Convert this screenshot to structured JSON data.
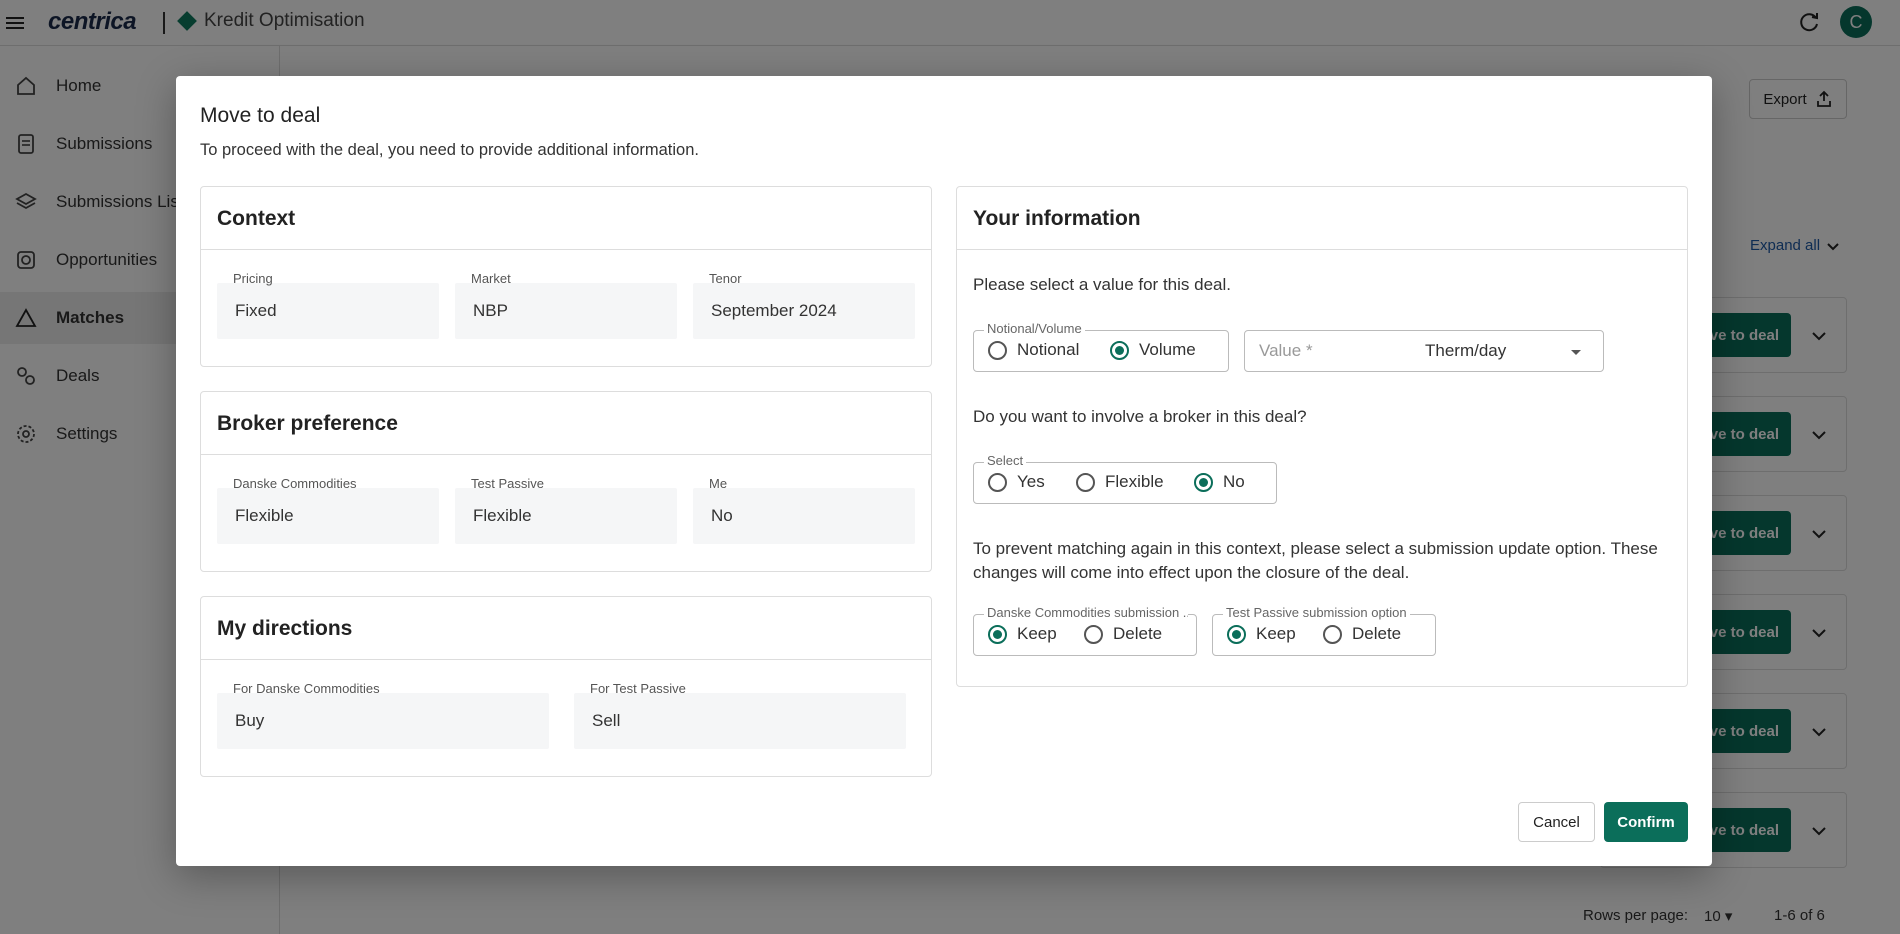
{
  "header": {
    "logo": "centrica",
    "product": "Kredit Optimisation",
    "avatar_initial": "C"
  },
  "sidebar": {
    "items": [
      {
        "label": "Home",
        "icon": "home-icon"
      },
      {
        "label": "Submissions",
        "icon": "document-icon"
      },
      {
        "label": "Submissions List",
        "icon": "layers-icon"
      },
      {
        "label": "Opportunities",
        "icon": "opportunities-icon"
      },
      {
        "label": "Matches",
        "icon": "triangle-icon"
      },
      {
        "label": "Deals",
        "icon": "deals-icon"
      },
      {
        "label": "Settings",
        "icon": "gear-icon"
      }
    ],
    "active": "Matches"
  },
  "main": {
    "export_label": "Export",
    "expand_all_label": "Expand all",
    "row_button_label": "Move to deal",
    "rows_per_page_label": "Rows per page:",
    "rows_per_page_value": "10",
    "pagination_text": "1-6 of 6"
  },
  "modal": {
    "title": "Move to deal",
    "subtitle": "To proceed with the deal, you need to provide additional information.",
    "context": {
      "title": "Context",
      "fields": [
        {
          "label": "Pricing",
          "value": "Fixed"
        },
        {
          "label": "Market",
          "value": "NBP"
        },
        {
          "label": "Tenor",
          "value": "September 2024"
        }
      ]
    },
    "broker": {
      "title": "Broker preference",
      "fields": [
        {
          "label": "Danske Commodities",
          "value": "Flexible"
        },
        {
          "label": "Test Passive",
          "value": "Flexible"
        },
        {
          "label": "Me",
          "value": "No"
        }
      ]
    },
    "directions": {
      "title": "My directions",
      "fields": [
        {
          "label": "For Danske Commodities",
          "value": "Buy"
        },
        {
          "label": "For Test Passive",
          "value": "Sell"
        }
      ]
    },
    "your_info": {
      "title": "Your information",
      "prompt_value": "Please select a value for this deal.",
      "nv_legend": "Notional/Volume",
      "nv_options": [
        "Notional",
        "Volume"
      ],
      "nv_selected": "Volume",
      "value_placeholder": "Value *",
      "unit": "Therm/day",
      "prompt_broker": "Do you want to involve a broker in this deal?",
      "broker_legend": "Select",
      "broker_options": [
        "Yes",
        "Flexible",
        "No"
      ],
      "broker_selected": "No",
      "prompt_update": "To prevent matching again in this context, please select a submission update option. These changes will come into effect upon the closure of the deal.",
      "danske_legend": "Danske Commodities submission ...",
      "passive_legend": "Test Passive submission option",
      "keep_label": "Keep",
      "delete_label": "Delete",
      "danske_selected": "Keep",
      "passive_selected": "Keep"
    },
    "cancel_label": "Cancel",
    "confirm_label": "Confirm"
  },
  "colors": {
    "accent": "#0b6e5a",
    "link": "#1f5aa6"
  }
}
